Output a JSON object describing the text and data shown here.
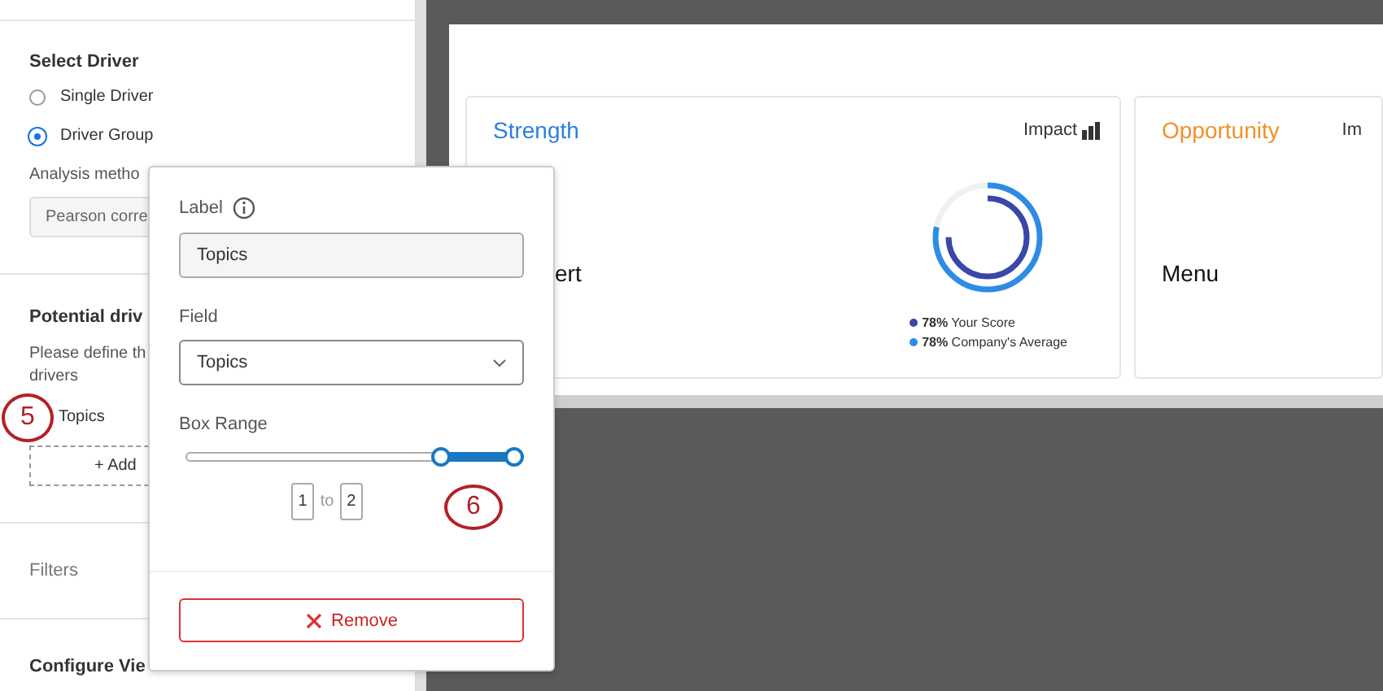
{
  "sidebar": {
    "select_driver": {
      "title": "Select Driver",
      "options": [
        {
          "label": "Single Driver",
          "selected": false
        },
        {
          "label": "Driver Group",
          "selected": true
        }
      ],
      "method_label": "Analysis metho",
      "method_value": "Pearson corre"
    },
    "potential": {
      "title": "Potential driv",
      "description": "Please define th",
      "description_2": "drivers",
      "driver": "Topics",
      "add": "+ Add"
    },
    "filters": "Filters",
    "configure": "Configure Vie"
  },
  "cards": [
    {
      "title": "Strength",
      "kind": "strength",
      "impact": "Impact",
      "text": "ert",
      "legend": [
        {
          "text": "**78%** Your Score",
          "color": "#3a46a8"
        },
        {
          "text": "**78%** Company's Average",
          "color": "#2d8ce6"
        }
      ]
    },
    {
      "title": "Opportunity",
      "kind": "opportunity",
      "impact": "Im",
      "text": "Menu"
    }
  ],
  "popover": {
    "label_title": "Label",
    "label_value": "Topics",
    "field_title": "Field",
    "field_value": "Topics",
    "range_title": "Box Range",
    "slider": {
      "level": 0.23
    },
    "range_from": "1",
    "range_word": "to",
    "range_to": "2",
    "remove": "Remove"
  },
  "callouts": [
    "5",
    "6"
  ]
}
